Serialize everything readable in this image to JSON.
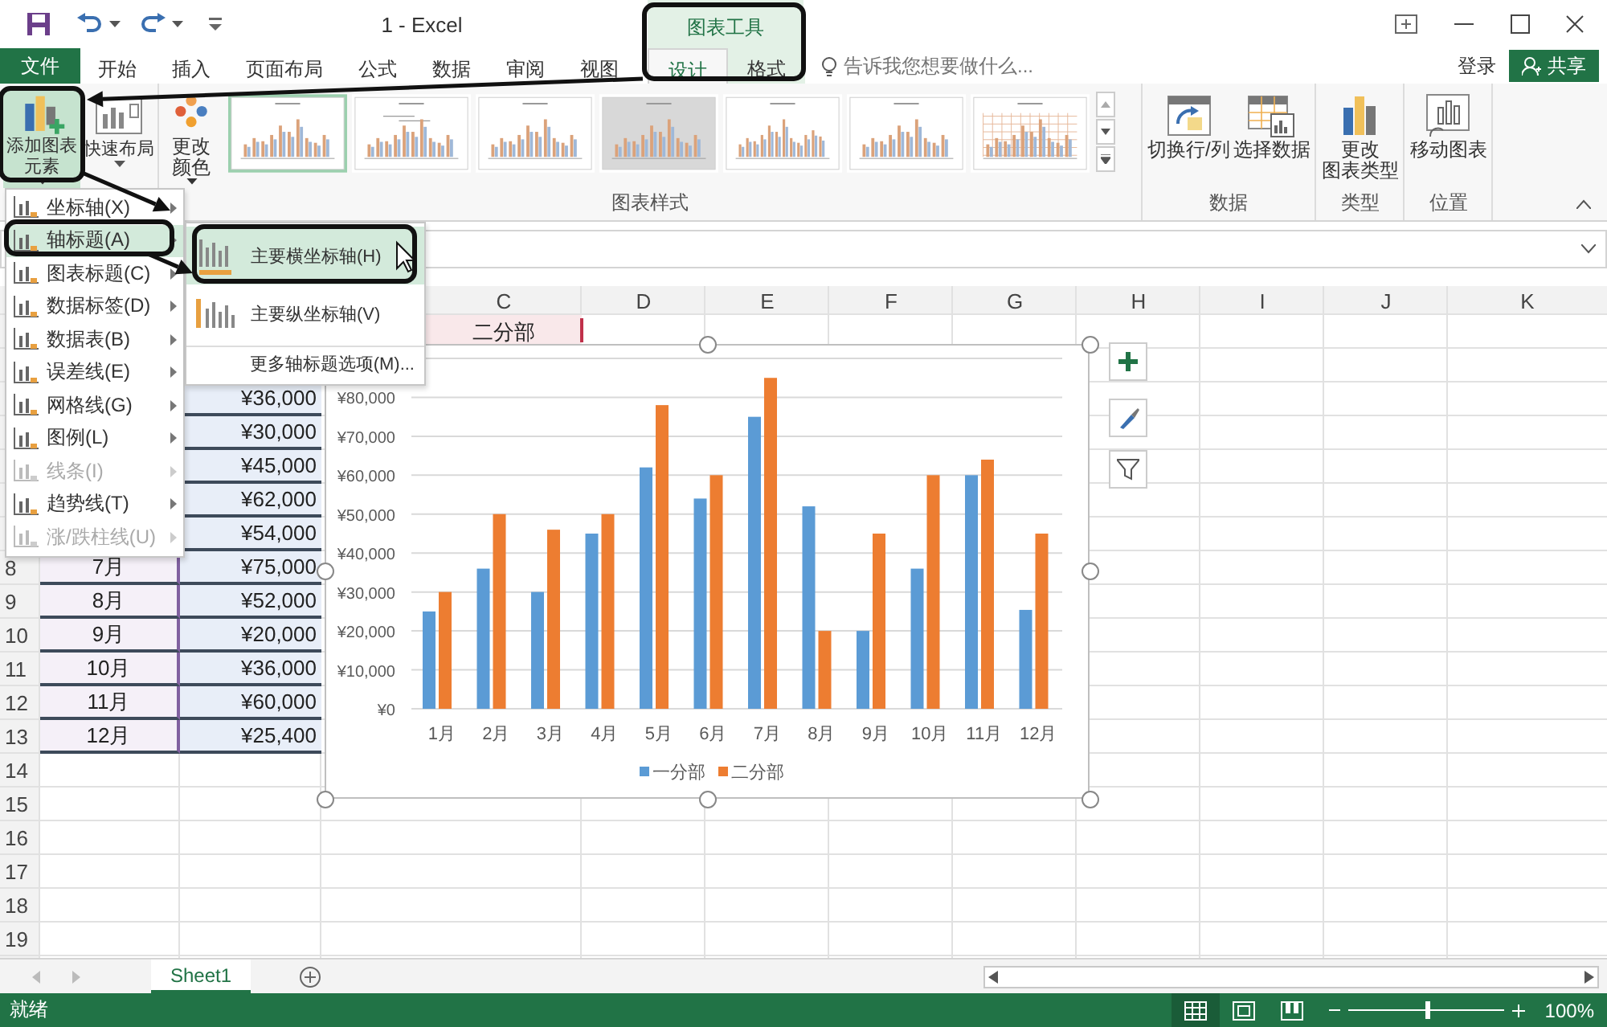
{
  "title_bar": {
    "title": "1 - Excel",
    "context_group": "图表工具"
  },
  "tabs": [
    {
      "label": "文件",
      "kind": "file",
      "selected": false
    },
    {
      "label": "开始",
      "kind": "normal",
      "selected": false
    },
    {
      "label": "插入",
      "kind": "normal",
      "selected": false
    },
    {
      "label": "页面布局",
      "kind": "normal",
      "selected": false
    },
    {
      "label": "公式",
      "kind": "normal",
      "selected": false
    },
    {
      "label": "数据",
      "kind": "normal",
      "selected": false
    },
    {
      "label": "审阅",
      "kind": "normal",
      "selected": false
    },
    {
      "label": "视图",
      "kind": "normal",
      "selected": false
    },
    {
      "label": "设计",
      "kind": "context",
      "selected": true
    },
    {
      "label": "格式",
      "kind": "context",
      "selected": false
    }
  ],
  "tell_me": {
    "placeholder": "告诉我您想要做什么..."
  },
  "sign_in": "登录",
  "share_button": "共享",
  "ribbon": {
    "layout_buttons": [
      {
        "label": "添加图表元素",
        "kind": "add-element",
        "expanded": true
      },
      {
        "label": "快速布局",
        "kind": "quick-layout",
        "expanded": false
      }
    ],
    "color_button": {
      "label": "更改颜色"
    },
    "style_gallery": {
      "label": "图表样式",
      "styles": [
        {
          "kind": "plain",
          "selected": true
        },
        {
          "kind": "labeled",
          "selected": false
        },
        {
          "kind": "plain",
          "selected": false
        },
        {
          "kind": "shaded",
          "selected": false
        },
        {
          "kind": "dense",
          "selected": false
        },
        {
          "kind": "plain",
          "selected": false
        },
        {
          "kind": "grid",
          "selected": false
        }
      ]
    },
    "groups": [
      {
        "label": "数据",
        "buttons": [
          {
            "label": "切换行/列",
            "kind": "switch"
          },
          {
            "label": "选择数据",
            "kind": "select-data"
          }
        ]
      },
      {
        "label": "类型",
        "buttons": [
          {
            "label": "更改图表类型",
            "kind": "change-type"
          }
        ]
      },
      {
        "label": "位置",
        "buttons": [
          {
            "label": "移动图表",
            "kind": "move"
          }
        ]
      }
    ]
  },
  "sheet": {
    "columns": [
      "C",
      "D",
      "E",
      "F",
      "G",
      "H",
      "I",
      "J",
      "K"
    ],
    "row_numbers": [
      "8",
      "9",
      "10",
      "11",
      "12",
      "13",
      "14",
      "15",
      "16",
      "17",
      "18",
      "19"
    ],
    "header_cell": "二分部",
    "month_cells": [
      "7月",
      "8月",
      "9月",
      "10月",
      "11月",
      "12月"
    ],
    "amount_cells": [
      "¥36,000",
      "¥30,000",
      "¥45,000",
      "¥62,000",
      "¥54,000",
      "¥75,000",
      "¥52,000",
      "¥20,000",
      "¥36,000",
      "¥60,000",
      "¥25,400"
    ]
  },
  "chart": {
    "chart_data": {
      "type": "bar",
      "categories": [
        "1月",
        "2月",
        "3月",
        "4月",
        "5月",
        "6月",
        "7月",
        "8月",
        "9月",
        "10月",
        "11月",
        "12月"
      ],
      "series": [
        {
          "name": "一分部",
          "color": "#5b9bd5",
          "values": [
            25000,
            36000,
            30000,
            45000,
            62000,
            54000,
            75000,
            52000,
            20000,
            36000,
            60000,
            25400
          ]
        },
        {
          "name": "二分部",
          "color": "#ed7d31",
          "values": [
            30000,
            50000,
            46000,
            50000,
            78000,
            60000,
            85000,
            20000,
            45000,
            60000,
            64000,
            45000
          ]
        }
      ],
      "ylim": [
        0,
        90000
      ],
      "grid": true,
      "legend": "bottom",
      "yticks": [
        {
          "value": 0,
          "label": "¥0"
        },
        {
          "value": 10000,
          "label": "¥10,000"
        },
        {
          "value": 20000,
          "label": "¥20,000"
        },
        {
          "value": 30000,
          "label": "¥30,000"
        },
        {
          "value": 40000,
          "label": "¥40,000"
        },
        {
          "value": 50000,
          "label": "¥50,000"
        },
        {
          "value": 60000,
          "label": "¥60,000"
        },
        {
          "value": 70000,
          "label": "¥70,000"
        },
        {
          "value": 80000,
          "label": "¥80,000"
        }
      ]
    }
  },
  "element_menu": {
    "items": [
      {
        "label": "坐标轴(X)",
        "selected": false,
        "disabled": false
      },
      {
        "label": "轴标题(A)",
        "selected": true,
        "disabled": false
      },
      {
        "label": "图表标题(C)",
        "selected": false,
        "disabled": false
      },
      {
        "label": "数据标签(D)",
        "selected": false,
        "disabled": false
      },
      {
        "label": "数据表(B)",
        "selected": false,
        "disabled": false
      },
      {
        "label": "误差线(E)",
        "selected": false,
        "disabled": false
      },
      {
        "label": "网格线(G)",
        "selected": false,
        "disabled": false
      },
      {
        "label": "图例(L)",
        "selected": false,
        "disabled": false
      },
      {
        "label": "线条(I)",
        "selected": false,
        "disabled": true
      },
      {
        "label": "趋势线(T)",
        "selected": false,
        "disabled": false
      },
      {
        "label": "涨/跌柱线(U)",
        "selected": false,
        "disabled": true
      }
    ]
  },
  "submenu": {
    "items": [
      {
        "label": "主要横坐标轴(H)",
        "kind": "horizontal",
        "selected": true
      },
      {
        "label": "主要纵坐标轴(V)",
        "kind": "vertical",
        "selected": false
      }
    ],
    "more_option": "更多轴标题选项(M)..."
  },
  "sheet_tabs": [
    {
      "label": "Sheet1",
      "selected": true
    }
  ],
  "status_bar": {
    "status": "就绪",
    "views": [
      {
        "kind": "normal",
        "selected": true
      },
      {
        "kind": "page-layout",
        "selected": false
      },
      {
        "kind": "page-break",
        "selected": false
      }
    ],
    "zoom": {
      "level": 0.5,
      "reading": "100%"
    }
  }
}
